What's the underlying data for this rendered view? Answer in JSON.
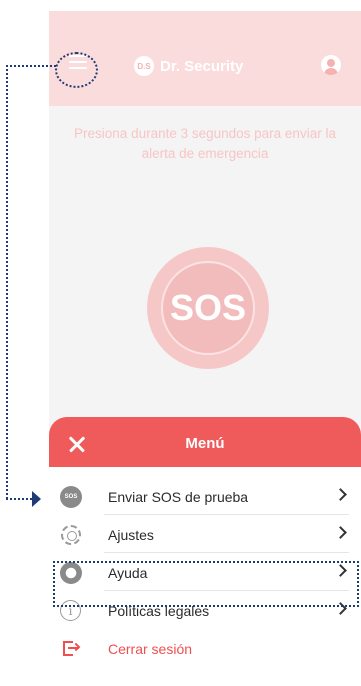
{
  "app": {
    "brand_logo_text": "D.S",
    "brand_name": "Dr. Security"
  },
  "home": {
    "instructions": "Presiona durante 3 segundos para enviar la alerta de emergencia",
    "sos_label": "SOS"
  },
  "menu": {
    "title": "Menú",
    "items": [
      {
        "label": "Enviar SOS de prueba",
        "icon": "sos-icon",
        "icon_text": "SOS"
      },
      {
        "label": "Ajustes",
        "icon": "gear-icon"
      },
      {
        "label": "Ayuda",
        "icon": "lifebuoy-icon"
      },
      {
        "label": "Políticas legales",
        "icon": "info-icon",
        "icon_text": "i"
      },
      {
        "label": "Cerrar sesión",
        "icon": "logout-icon"
      }
    ]
  },
  "colors": {
    "brand_red": "#ef5a5a",
    "annotation": "#1f3b73"
  }
}
